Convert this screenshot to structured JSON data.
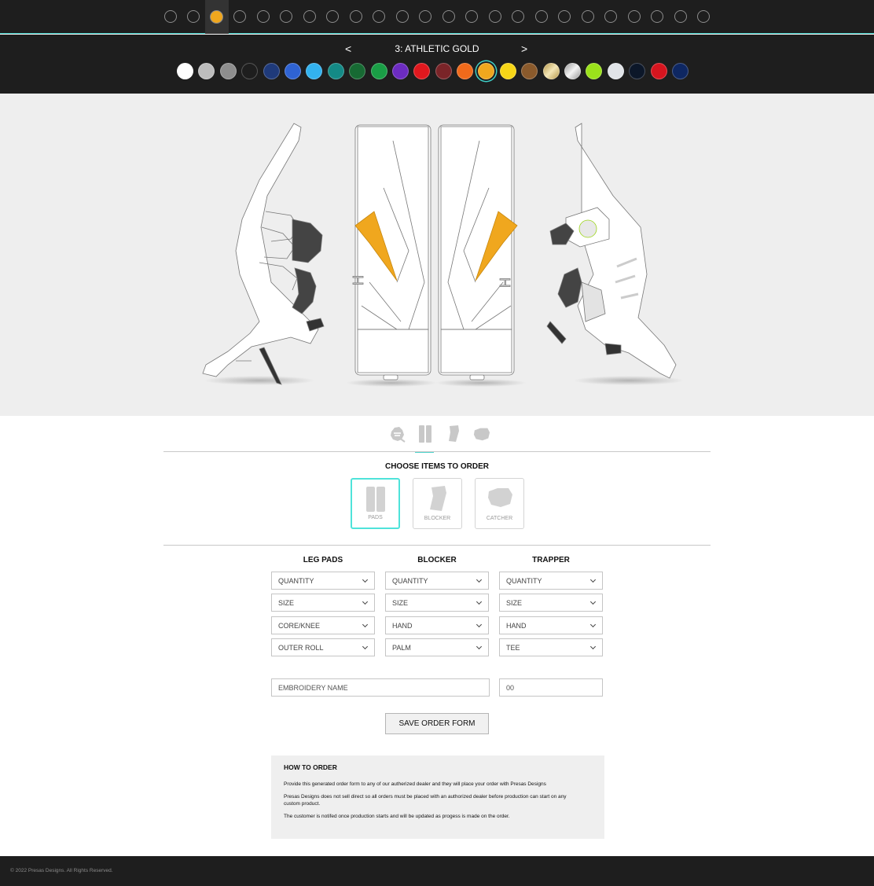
{
  "steps": {
    "count": 24,
    "active_index": 2,
    "active_color": "#f0a71e"
  },
  "color_selector": {
    "prev_label": "<",
    "next_label": ">",
    "current_label": "3:  ATHLETIC GOLD",
    "selected_index": 14,
    "swatches": [
      {
        "name": "white",
        "hex": "#ffffff"
      },
      {
        "name": "silver-light",
        "hex": "#bdbdbd"
      },
      {
        "name": "grey",
        "hex": "#8e8e8e"
      },
      {
        "name": "black",
        "hex": "#1e1e1e"
      },
      {
        "name": "navy-royal",
        "hex": "#1f3a7a"
      },
      {
        "name": "royal-blue",
        "hex": "#2f63d3"
      },
      {
        "name": "sky-blue",
        "hex": "#33b2ef"
      },
      {
        "name": "teal",
        "hex": "#148a86"
      },
      {
        "name": "dark-green",
        "hex": "#176a33"
      },
      {
        "name": "kelly-green",
        "hex": "#1a9e46"
      },
      {
        "name": "purple",
        "hex": "#6c2cc1"
      },
      {
        "name": "red",
        "hex": "#e0181e"
      },
      {
        "name": "maroon",
        "hex": "#7a2428"
      },
      {
        "name": "orange",
        "hex": "#f06a1b"
      },
      {
        "name": "athletic-gold",
        "hex": "#f0a71e"
      },
      {
        "name": "yellow",
        "hex": "#f7d617"
      },
      {
        "name": "brown",
        "hex": "#8a5a2c"
      },
      {
        "name": "metallic-gold",
        "hex": "#d8c184"
      },
      {
        "name": "metallic-silver",
        "hex": "#d0d0d0"
      },
      {
        "name": "lime",
        "hex": "#9be21b"
      },
      {
        "name": "pearl",
        "hex": "#e1e4e8"
      },
      {
        "name": "midnight-navy",
        "hex": "#0c1729"
      },
      {
        "name": "scarlet",
        "hex": "#d6151f"
      },
      {
        "name": "dark-navy",
        "hex": "#0e2762"
      }
    ]
  },
  "accent_color": "#f0a71e",
  "view_tabs": [
    "mask-icon",
    "pads-icon",
    "blocker-icon",
    "catcher-icon"
  ],
  "choose_items": {
    "title": "CHOOSE ITEMS TO ORDER",
    "items": [
      {
        "label": "PADS",
        "selected": true
      },
      {
        "label": "BLOCKER",
        "selected": false
      },
      {
        "label": "CATCHER",
        "selected": false
      }
    ]
  },
  "order_form": {
    "columns": [
      {
        "heading": "LEG PADS",
        "selects": [
          "QUANTITY",
          "SIZE",
          "CORE/KNEE",
          "OUTER ROLL"
        ]
      },
      {
        "heading": "BLOCKER",
        "selects": [
          "QUANTITY",
          "SIZE",
          "HAND",
          "PALM"
        ]
      },
      {
        "heading": "TRAPPER",
        "selects": [
          "QUANTITY",
          "SIZE",
          "HAND",
          "TEE"
        ]
      }
    ],
    "embroidery_placeholder": "EMBROIDERY NAME",
    "number_placeholder": "00",
    "save_label": "SAVE ORDER FORM"
  },
  "how_to_order": {
    "title": "HOW TO ORDER",
    "paragraphs": [
      "Provide this generated order form to any of our autherized dealer and they will place your order with Presas Designs",
      "Presas Designs does not sell direct so all orders must be placed with an authorized dealer before production can start on any custom product.",
      "The customer is notifed once production starts and will be updated as progess is made on the order."
    ]
  },
  "footer": {
    "copyright": "© 2022 Presas Designs. All Rights Reserved."
  }
}
